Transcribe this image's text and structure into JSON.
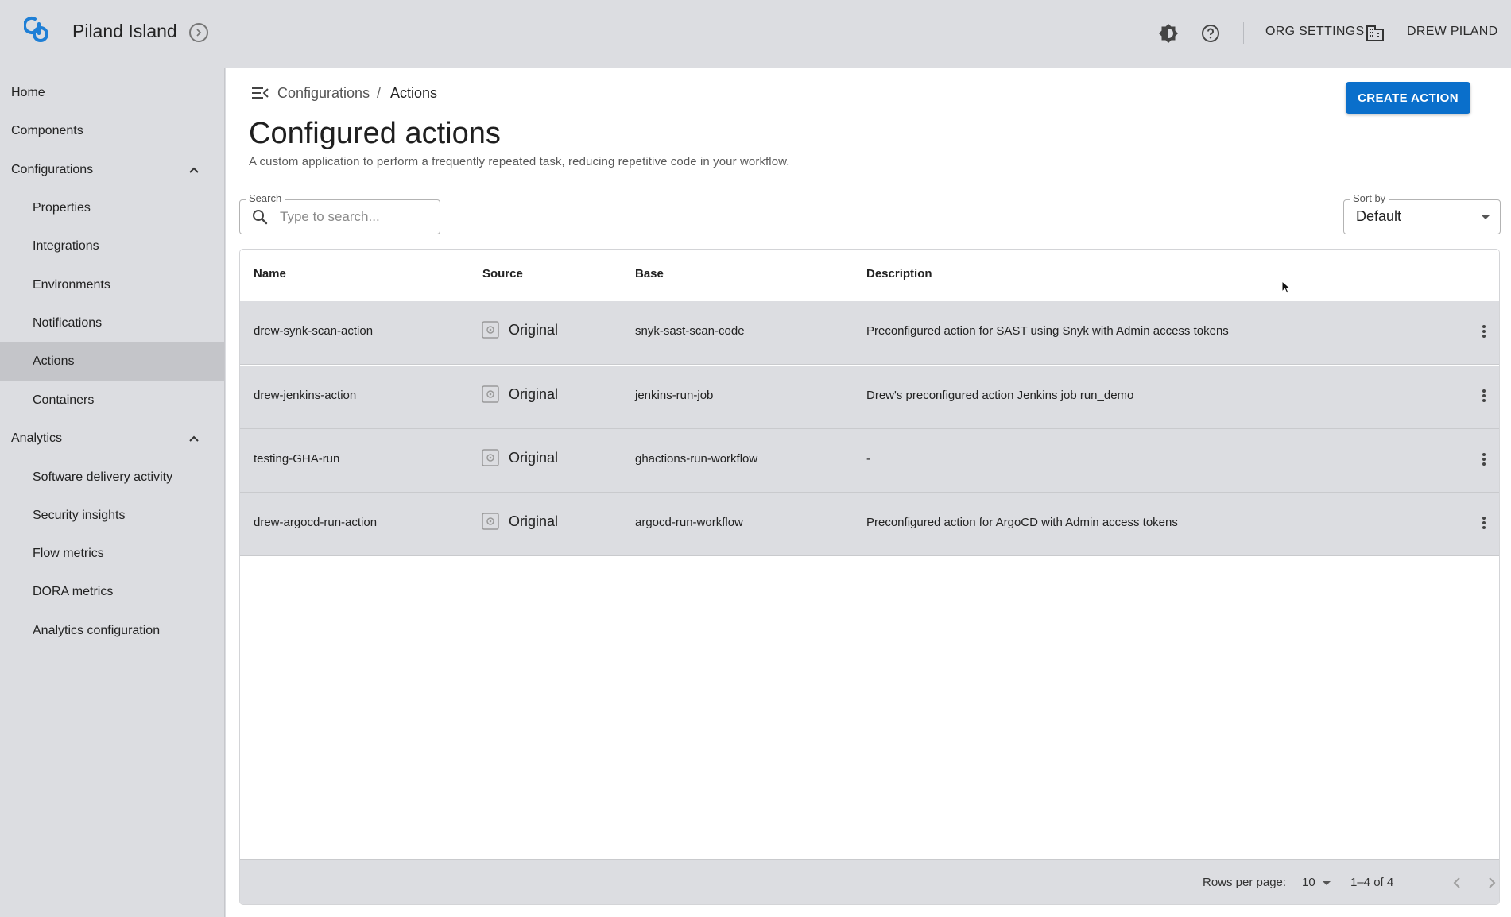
{
  "topbar": {
    "org_name": "Piland Island",
    "org_settings": "ORG SETTINGS",
    "user_name": "DREW PILAND",
    "icons": [
      "logo-icon",
      "org-switch-icon",
      "theme-toggle-icon",
      "help-icon",
      "building-icon"
    ]
  },
  "sidebar": {
    "items": [
      {
        "label": "Home",
        "level": "top"
      },
      {
        "label": "Components",
        "level": "top"
      },
      {
        "label": "Configurations",
        "level": "top",
        "expanded": true
      },
      {
        "label": "Properties",
        "level": "sub"
      },
      {
        "label": "Integrations",
        "level": "sub"
      },
      {
        "label": "Environments",
        "level": "sub"
      },
      {
        "label": "Notifications",
        "level": "sub"
      },
      {
        "label": "Actions",
        "level": "sub",
        "active": true
      },
      {
        "label": "Containers",
        "level": "sub"
      },
      {
        "label": "Analytics",
        "level": "top",
        "expanded": true
      },
      {
        "label": "Software delivery activity",
        "level": "sub"
      },
      {
        "label": "Security insights",
        "level": "sub"
      },
      {
        "label": "Flow metrics",
        "level": "sub"
      },
      {
        "label": "DORA metrics",
        "level": "sub"
      },
      {
        "label": "Analytics configuration",
        "level": "sub"
      }
    ]
  },
  "breadcrumb": {
    "parent": "Configurations",
    "separator": "/",
    "current": "Actions"
  },
  "header": {
    "title": "Configured actions",
    "subtitle": "A custom application to perform a frequently repeated task, reducing repetitive code in your workflow.",
    "create_button": "CREATE ACTION"
  },
  "search": {
    "label": "Search",
    "placeholder": "Type to search...",
    "value": ""
  },
  "sort": {
    "label": "Sort by",
    "value": "Default"
  },
  "table": {
    "columns": [
      "Name",
      "Source",
      "Base",
      "Description"
    ],
    "rows": [
      {
        "name": "drew-synk-scan-action",
        "source": "Original",
        "base": "snyk-sast-scan-code",
        "description": "Preconfigured action for SAST using Snyk with Admin access tokens"
      },
      {
        "name": "drew-jenkins-action",
        "source": "Original",
        "base": "jenkins-run-job",
        "description": "Drew's preconfigured action Jenkins job run_demo"
      },
      {
        "name": "testing-GHA-run",
        "source": "Original",
        "base": "ghactions-run-workflow",
        "description": "-"
      },
      {
        "name": "drew-argocd-run-action",
        "source": "Original",
        "base": "argocd-run-workflow",
        "description": "Preconfigured action for ArgoCD with Admin access tokens"
      }
    ]
  },
  "pagination": {
    "rows_per_page_label": "Rows per page:",
    "rows_per_page": "10",
    "range": "1–4 of 4"
  },
  "colors": {
    "accent": "#0a6fcb",
    "chrome_bg": "#dcdde1",
    "active_nav": "#c4c5c9",
    "content_bg": "#ffffff"
  }
}
